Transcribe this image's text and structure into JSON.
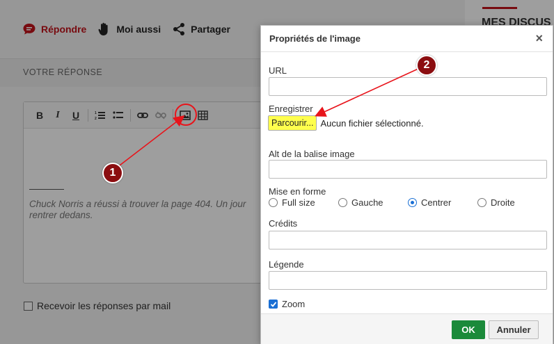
{
  "actions": {
    "reply": "Répondre",
    "me_too": "Moi aussi",
    "share": "Partager"
  },
  "section": {
    "your_reply": "VOTRE RÉPONSE"
  },
  "editor": {
    "toolbar": [
      "bold-icon",
      "italic-icon",
      "underline-icon",
      "ordered-list-icon",
      "bullet-list-icon",
      "link-icon",
      "unlink-icon",
      "image-icon",
      "table-icon"
    ],
    "bold": "B",
    "italic": "I",
    "underline": "U",
    "signature_line1": "Chuck Norris a réussi à trouver la page 404. Un jour",
    "signature_line2": "rentrer dedans."
  },
  "mail_option": "Recevoir les réponses par mail",
  "sidebar": {
    "title": "MES DISCUS"
  },
  "dialog": {
    "title": "Propriétés de l'image",
    "close": "×",
    "url_label": "URL",
    "url_value": "",
    "save_label": "Enregistrer",
    "browse_button": "Parcourir...",
    "browse_status": "Aucun fichier sélectionné.",
    "alt_label": "Alt de la balise image",
    "alt_value": "",
    "layout_label": "Mise en forme",
    "layout_options": [
      "Full size",
      "Gauche",
      "Centrer",
      "Droite"
    ],
    "layout_selected": "Centrer",
    "credits_label": "Crédits",
    "credits_value": "",
    "caption_label": "Légende",
    "caption_value": "",
    "zoom_label": "Zoom",
    "zoom_checked": true,
    "ok": "OK",
    "cancel": "Annuler"
  },
  "annotations": {
    "step1": "1",
    "step2": "2",
    "color": "#e8141b"
  },
  "colors": {
    "brand_red": "#c2121b",
    "ok_green": "#1b8a3a",
    "highlight_yellow": "#ffff4d",
    "accent_blue": "#1a6fd4"
  }
}
